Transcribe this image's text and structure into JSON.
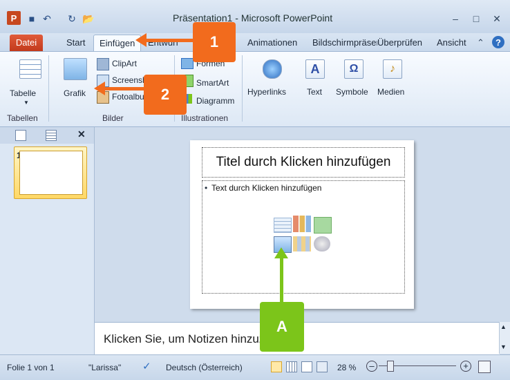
{
  "window": {
    "title": "Präsentation1 - Microsoft PowerPoint",
    "controls": [
      "minimize",
      "maximize",
      "close"
    ]
  },
  "tabs": [
    {
      "label": "Datei"
    },
    {
      "label": "Start"
    },
    {
      "label": "Einfügen",
      "active": true
    },
    {
      "label": "Entwurf"
    },
    {
      "label": "Animationen"
    },
    {
      "label": "Bildschirmpräsentation"
    },
    {
      "label": "Überprüfen"
    },
    {
      "label": "Ansicht"
    }
  ],
  "ribbon": {
    "groups": [
      {
        "label": "Tabellen",
        "buttons": [
          {
            "label": "Tabelle"
          }
        ]
      },
      {
        "label": "Bilder",
        "buttons": [
          {
            "label": "Grafik"
          },
          {
            "label": "ClipArt"
          },
          {
            "label": "Screenshot"
          },
          {
            "label": "Fotoalbum"
          }
        ]
      },
      {
        "label": "Illustrationen",
        "buttons": [
          {
            "label": "Formen"
          },
          {
            "label": "SmartArt"
          },
          {
            "label": "Diagramm"
          }
        ]
      },
      {
        "label": "",
        "buttons": [
          {
            "label": "Hyperlinks"
          },
          {
            "label": "Text"
          },
          {
            "label": "Symbole"
          },
          {
            "label": "Medien"
          }
        ]
      }
    ]
  },
  "slide_panel": {
    "slide_number": "1"
  },
  "slide": {
    "title_placeholder": "Titel durch Klicken hinzufügen",
    "body_placeholder": "Text durch Klicken hinzufügen"
  },
  "notes": {
    "placeholder": "Klicken Sie, um Notizen hinzuzufügen"
  },
  "status": {
    "slide_info": "Folie 1 von 1",
    "theme": "\"Larissa\"",
    "language": "Deutsch (Österreich)",
    "zoom": "28 %"
  },
  "callouts": [
    {
      "label": "1"
    },
    {
      "label": "2"
    },
    {
      "label": "A"
    }
  ],
  "colors": {
    "callout_orange": "#f26b1d",
    "callout_green": "#7cc51a",
    "file_tab": "#c94322"
  }
}
